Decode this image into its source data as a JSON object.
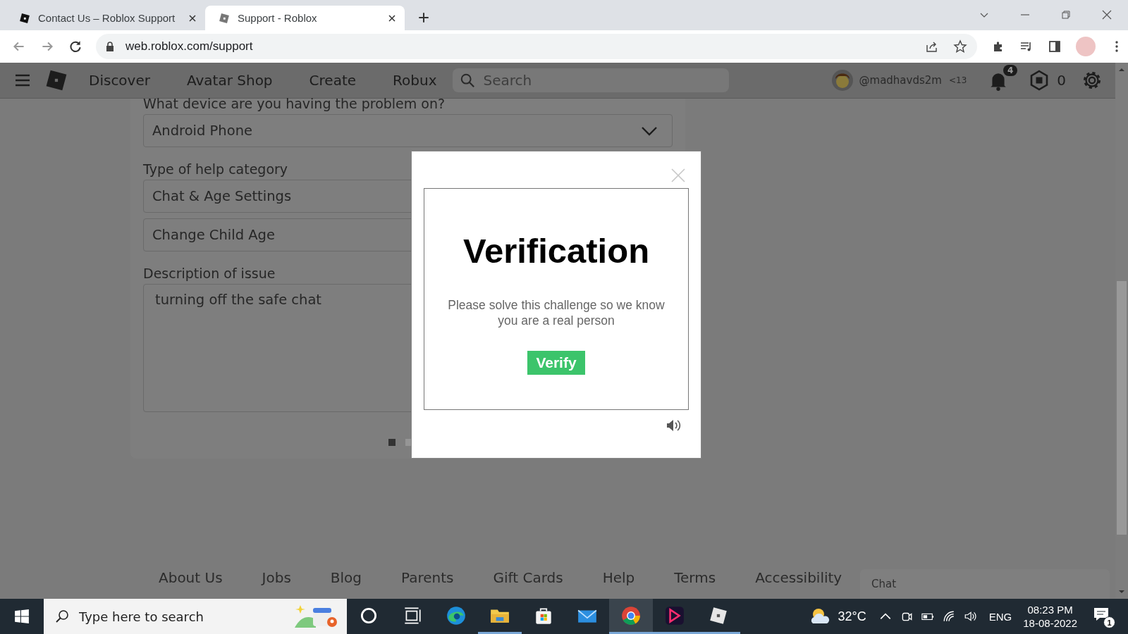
{
  "browser": {
    "tabs": [
      {
        "title": "Contact Us – Roblox Support",
        "selected": false
      },
      {
        "title": "Support - Roblox",
        "selected": true
      }
    ],
    "url": "web.roblox.com/support"
  },
  "nav": {
    "links": [
      "Discover",
      "Avatar Shop",
      "Create",
      "Robux"
    ],
    "search": {
      "placeholder": "Search"
    },
    "username": "@madhavds2m",
    "age_tag": "<13",
    "notifications": "4",
    "robux": "0"
  },
  "form": {
    "device": {
      "label": "What device are you having the problem on?",
      "value": "Android Phone"
    },
    "category": {
      "label": "Type of help category",
      "values": [
        "Chat & Age Settings",
        "Change Child Age"
      ]
    },
    "description": {
      "label": "Description of issue",
      "value": "turning off the safe chat"
    },
    "pages": [
      {
        "selected": true
      },
      {
        "selected": false
      }
    ]
  },
  "modal": {
    "title": "Verification",
    "message": "Please solve this challenge so we know you are a real person",
    "button": "Verify"
  },
  "footer": {
    "links": [
      "About Us",
      "Jobs",
      "Blog",
      "Parents",
      "Gift Cards",
      "Help",
      "Terms",
      "Accessibility"
    ]
  },
  "chat": {
    "label": "Chat"
  },
  "taskbar": {
    "search": {
      "placeholder": "Type here to search"
    },
    "apps": [
      {
        "kind": "cortana",
        "running": false,
        "selected": false
      },
      {
        "kind": "taskview",
        "running": false,
        "selected": false
      },
      {
        "kind": "edge",
        "running": false,
        "selected": false
      },
      {
        "kind": "explorer",
        "running": true,
        "selected": false
      },
      {
        "kind": "store",
        "running": false,
        "selected": false
      },
      {
        "kind": "mail",
        "running": false,
        "selected": false
      },
      {
        "kind": "chrome",
        "running": true,
        "selected": true
      },
      {
        "kind": "editor",
        "running": true,
        "selected": false
      },
      {
        "kind": "roblox",
        "running": true,
        "selected": false
      }
    ],
    "weather": "32°C",
    "language": "ENG",
    "time": "08:23 PM",
    "date": "18-08-2022",
    "notifications": "1"
  }
}
